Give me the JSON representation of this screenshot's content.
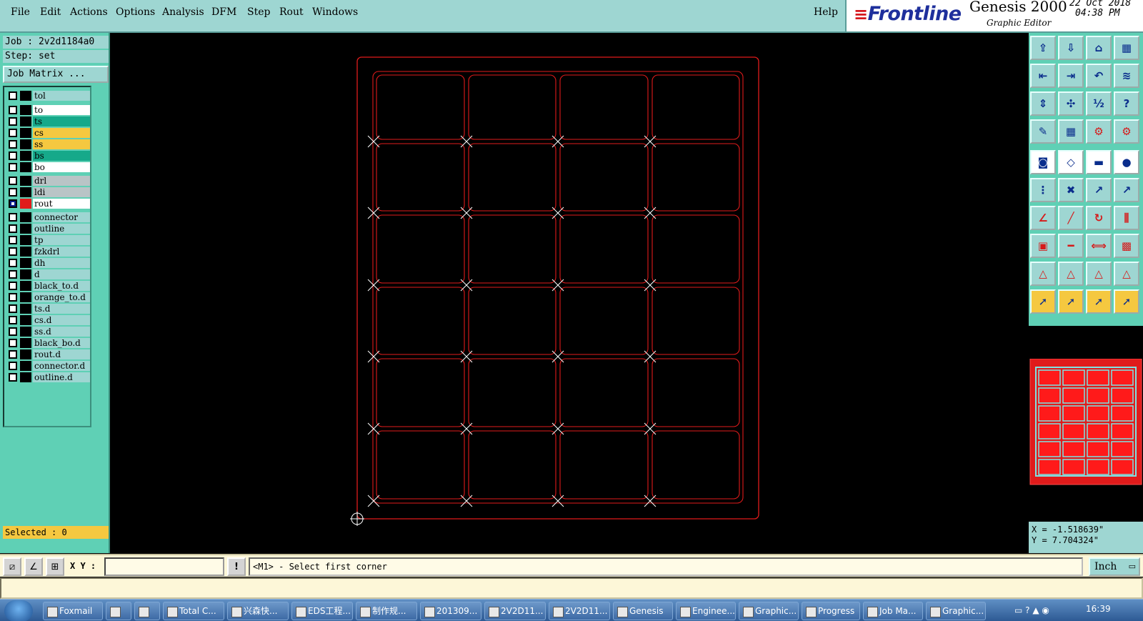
{
  "menubar": {
    "items": [
      "File",
      "Edit",
      "Actions",
      "Options",
      "Analysis",
      "DFM",
      "Step",
      "Rout",
      "Windows"
    ],
    "help": "Help"
  },
  "brand": {
    "logo": "Frontline",
    "product": "Genesis 2000",
    "editor": "Graphic Editor",
    "date": "22 Oct 2018",
    "time": "04:38 PM"
  },
  "job": {
    "job_label": "Job : 2v2d1184a0",
    "step_label": "Step: set",
    "matrix_button": "Job Matrix ..."
  },
  "layers": [
    {
      "name": "tol",
      "color": "#9ed6d2"
    },
    {
      "name": "to",
      "color": "#ffffff"
    },
    {
      "name": "ts",
      "color": "#16a98a"
    },
    {
      "name": "cs",
      "color": "#f5c840"
    },
    {
      "name": "ss",
      "color": "#f5c840"
    },
    {
      "name": "bs",
      "color": "#16a98a"
    },
    {
      "name": "bo",
      "color": "#ffffff"
    },
    {
      "name": "drl",
      "color": "#b9c4c6"
    },
    {
      "name": "ldi",
      "color": "#b9c4c6"
    },
    {
      "name": "rout",
      "color": "#ffffff",
      "active": true
    },
    {
      "name": "connector",
      "color": "#9ed6d2"
    },
    {
      "name": "outline",
      "color": "#9ed6d2"
    },
    {
      "name": "tp",
      "color": "#9ed6d2"
    },
    {
      "name": "fzkdrl",
      "color": "#9ed6d2"
    },
    {
      "name": "dh",
      "color": "#9ed6d2"
    },
    {
      "name": "d",
      "color": "#9ed6d2"
    },
    {
      "name": "black_to.d",
      "color": "#9ed6d2"
    },
    {
      "name": "orange_to.d",
      "color": "#9ed6d2"
    },
    {
      "name": "ts.d",
      "color": "#9ed6d2"
    },
    {
      "name": "cs.d",
      "color": "#9ed6d2"
    },
    {
      "name": "ss.d",
      "color": "#9ed6d2"
    },
    {
      "name": "black_bo.d",
      "color": "#9ed6d2"
    },
    {
      "name": "rout.d",
      "color": "#9ed6d2"
    },
    {
      "name": "connector.d",
      "color": "#9ed6d2"
    },
    {
      "name": "outline.d",
      "color": "#9ed6d2"
    }
  ],
  "selected_label": "Selected : 0",
  "coords": {
    "x": "X = -1.518639\"",
    "y": "Y = 7.704324\""
  },
  "prompt": {
    "xy_label": "X Y :",
    "xy_value": "",
    "message": "<M1> - Select first corner",
    "unit": "Inch"
  },
  "taskbar": {
    "tasks": [
      "Foxmail",
      "",
      "",
      "Total C...",
      "兴森快...",
      "EDS工程...",
      "制作规...",
      "201309...",
      "2V2D11...",
      "2V2D11...",
      "Genesis",
      "Enginee...",
      "Graphic...",
      "Progress",
      "Job Ma...",
      "Graphic..."
    ],
    "clock": "16:39"
  },
  "colors": {
    "rout": "#e01b1b",
    "panel": "#5fd0b5",
    "menubar": "#9ed6d2"
  }
}
